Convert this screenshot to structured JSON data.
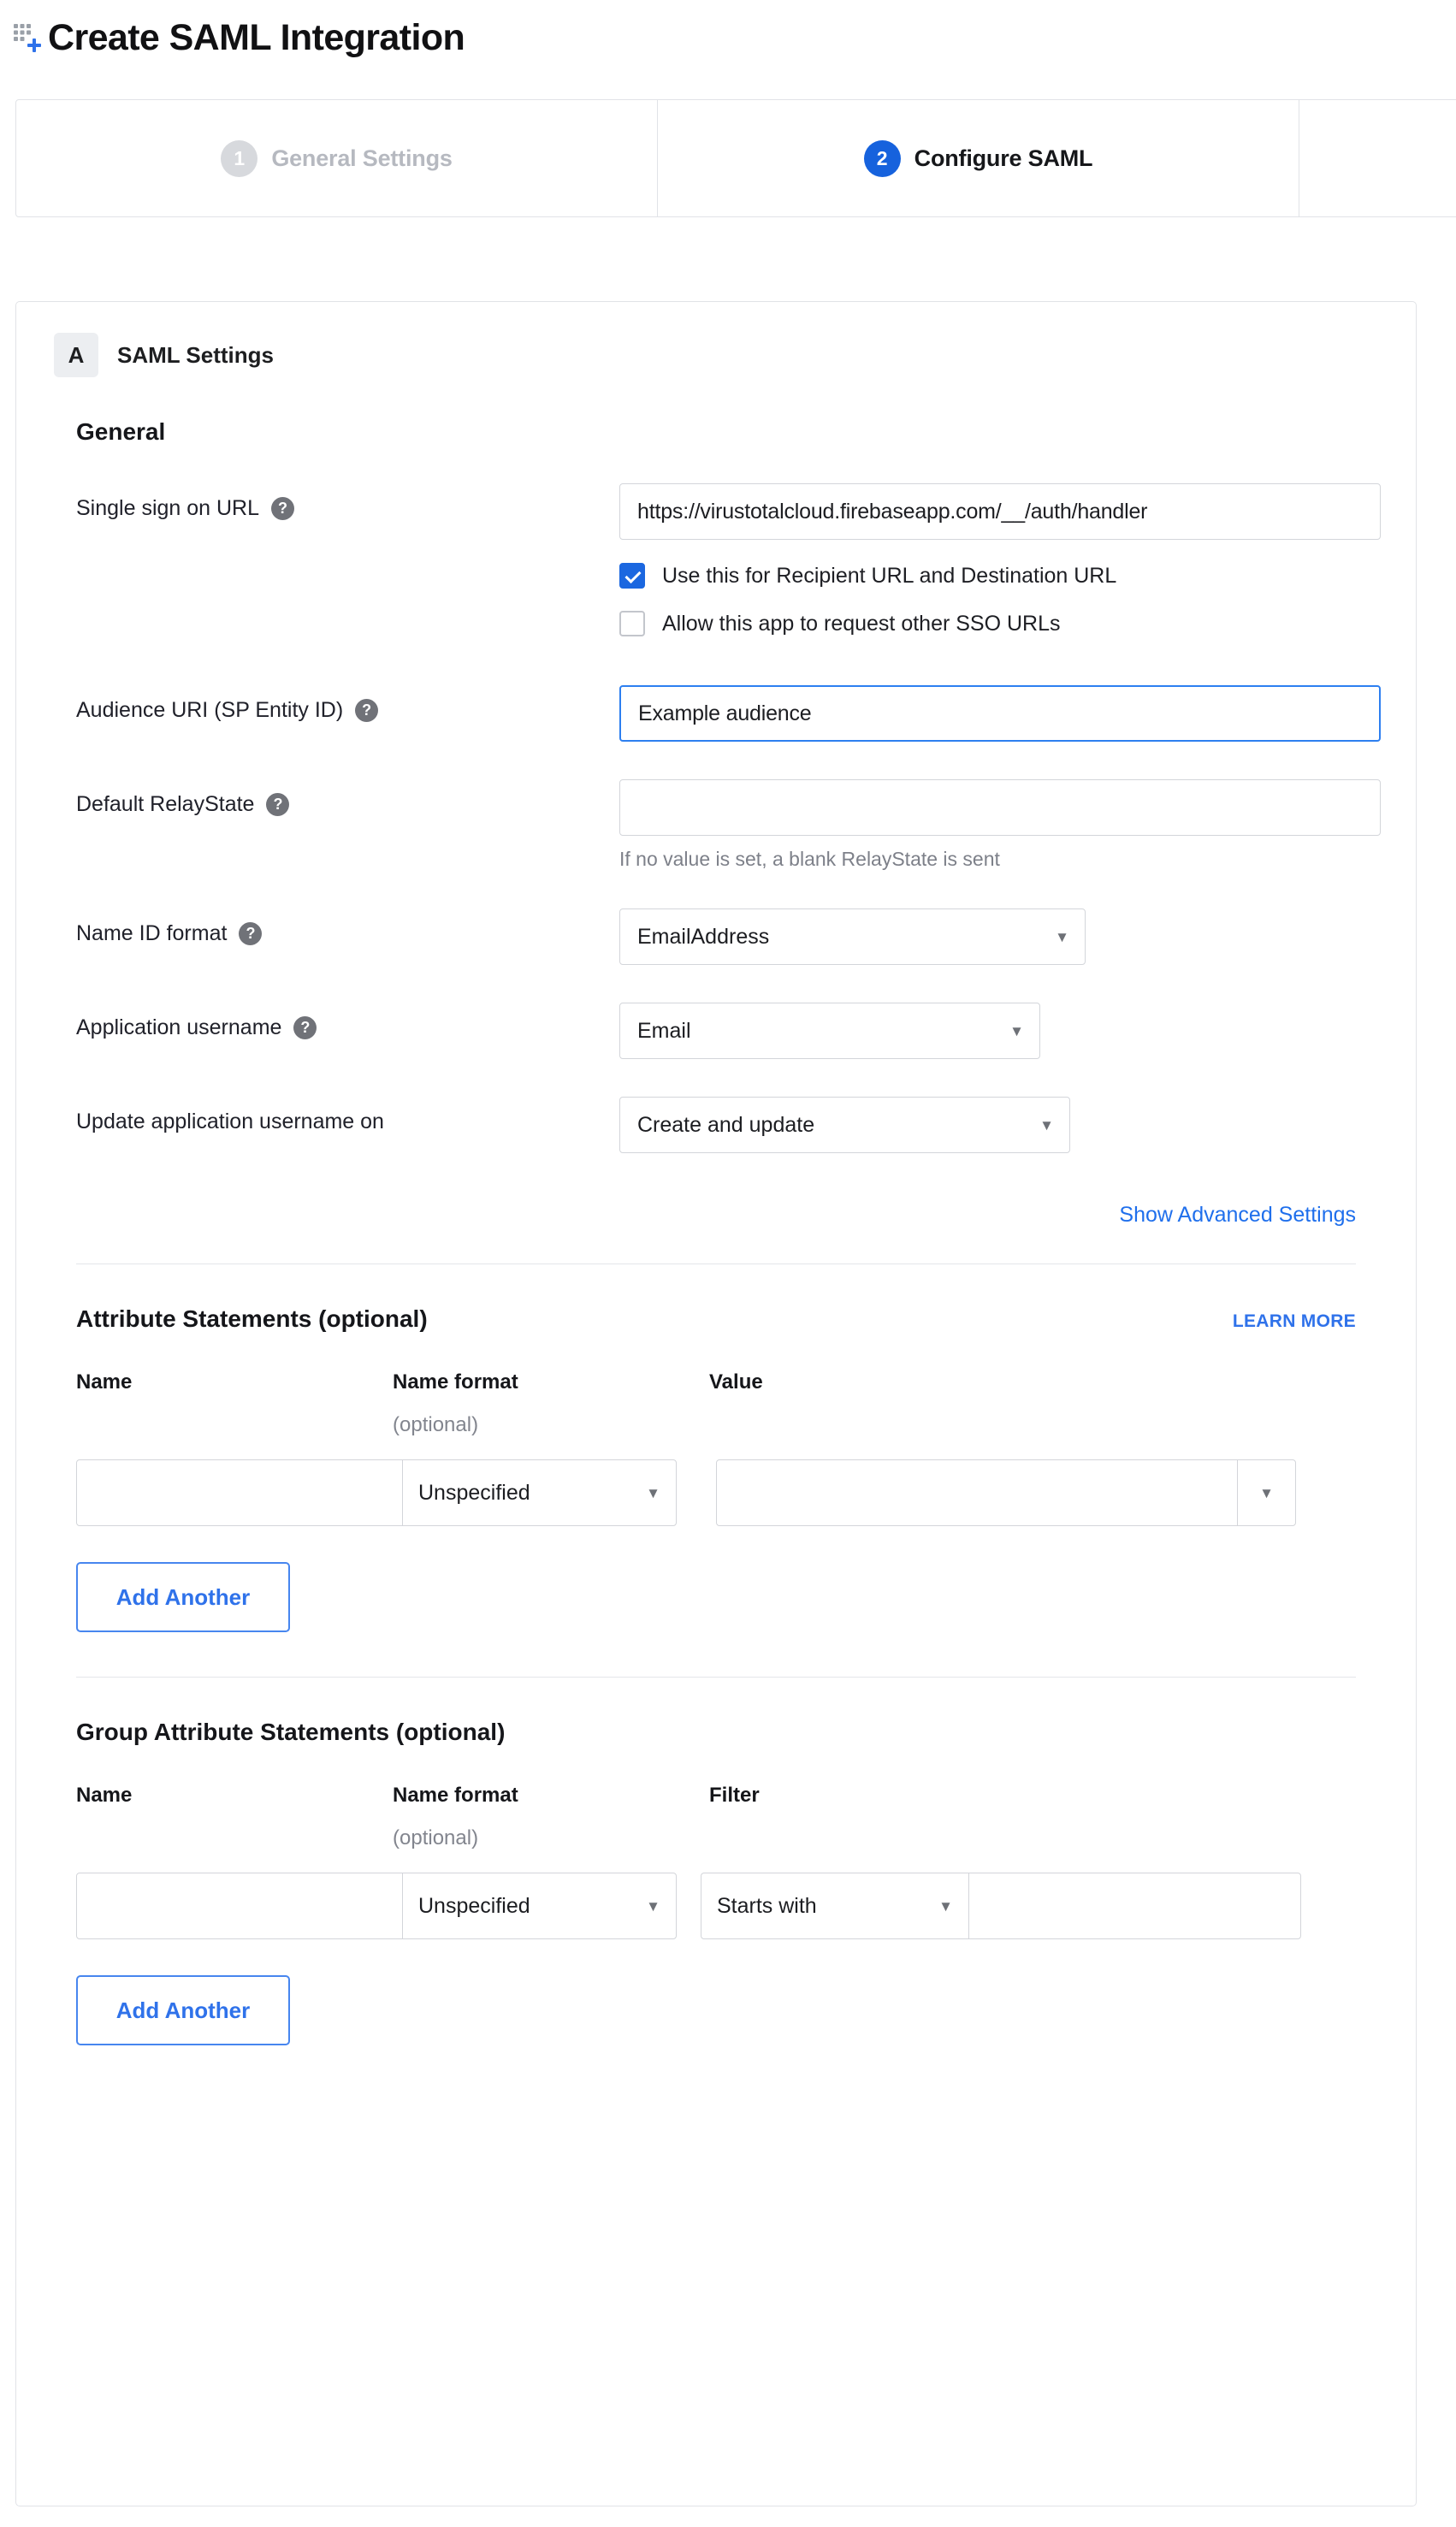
{
  "header": {
    "title": "Create SAML Integration",
    "icon": "grid-plus-icon"
  },
  "wizard": {
    "tabs": [
      {
        "number": "1",
        "label": "General Settings",
        "active": false
      },
      {
        "number": "2",
        "label": "Configure SAML",
        "active": true
      }
    ]
  },
  "card": {
    "badge_letter": "A",
    "title": "SAML Settings",
    "general_heading": "General",
    "fields": {
      "sso_url": {
        "label": "Single sign on URL",
        "help": "?",
        "value": "https://virustotalcloud.firebaseapp.com/__/auth/handler",
        "checkboxes": [
          {
            "label": "Use this for Recipient URL and Destination URL",
            "checked": true
          },
          {
            "label": "Allow this app to request other SSO URLs",
            "checked": false
          }
        ]
      },
      "audience_uri": {
        "label": "Audience URI (SP Entity ID)",
        "help": "?",
        "value": "Example audience",
        "focused": true
      },
      "default_relaystate": {
        "label": "Default RelayState",
        "help": "?",
        "value": "",
        "hint": "If no value is set, a blank RelayState is sent"
      },
      "name_id_format": {
        "label": "Name ID format",
        "help": "?",
        "value": "EmailAddress"
      },
      "application_username": {
        "label": "Application username",
        "help": "?",
        "value": "Email"
      },
      "update_application_username_on": {
        "label": "Update application username on",
        "value": "Create and update"
      }
    },
    "advanced_link": "Show Advanced Settings",
    "attribute_statements": {
      "heading": "Attribute Statements (optional)",
      "learn_more": "LEARN MORE",
      "columns": {
        "name": "Name",
        "name_format": "Name format",
        "name_format_optional": "(optional)",
        "value": "Value"
      },
      "row": {
        "name_value": "",
        "name_format_value": "Unspecified",
        "value_value": ""
      },
      "add_button": "Add Another"
    },
    "group_attribute_statements": {
      "heading": "Group Attribute Statements (optional)",
      "columns": {
        "name": "Name",
        "name_format": "Name format",
        "name_format_optional": "(optional)",
        "filter": "Filter"
      },
      "row": {
        "name_value": "",
        "name_format_value": "Unspecified",
        "filter_op_value": "Starts with",
        "filter_value": ""
      },
      "add_button": "Add Another"
    }
  },
  "colors": {
    "accent_blue": "#1662dd",
    "link_blue": "#1f6fec",
    "checkbox_blue": "#1b67e0",
    "border_grey": "#d3d5da"
  },
  "icons": {
    "caret_down": "▼"
  }
}
